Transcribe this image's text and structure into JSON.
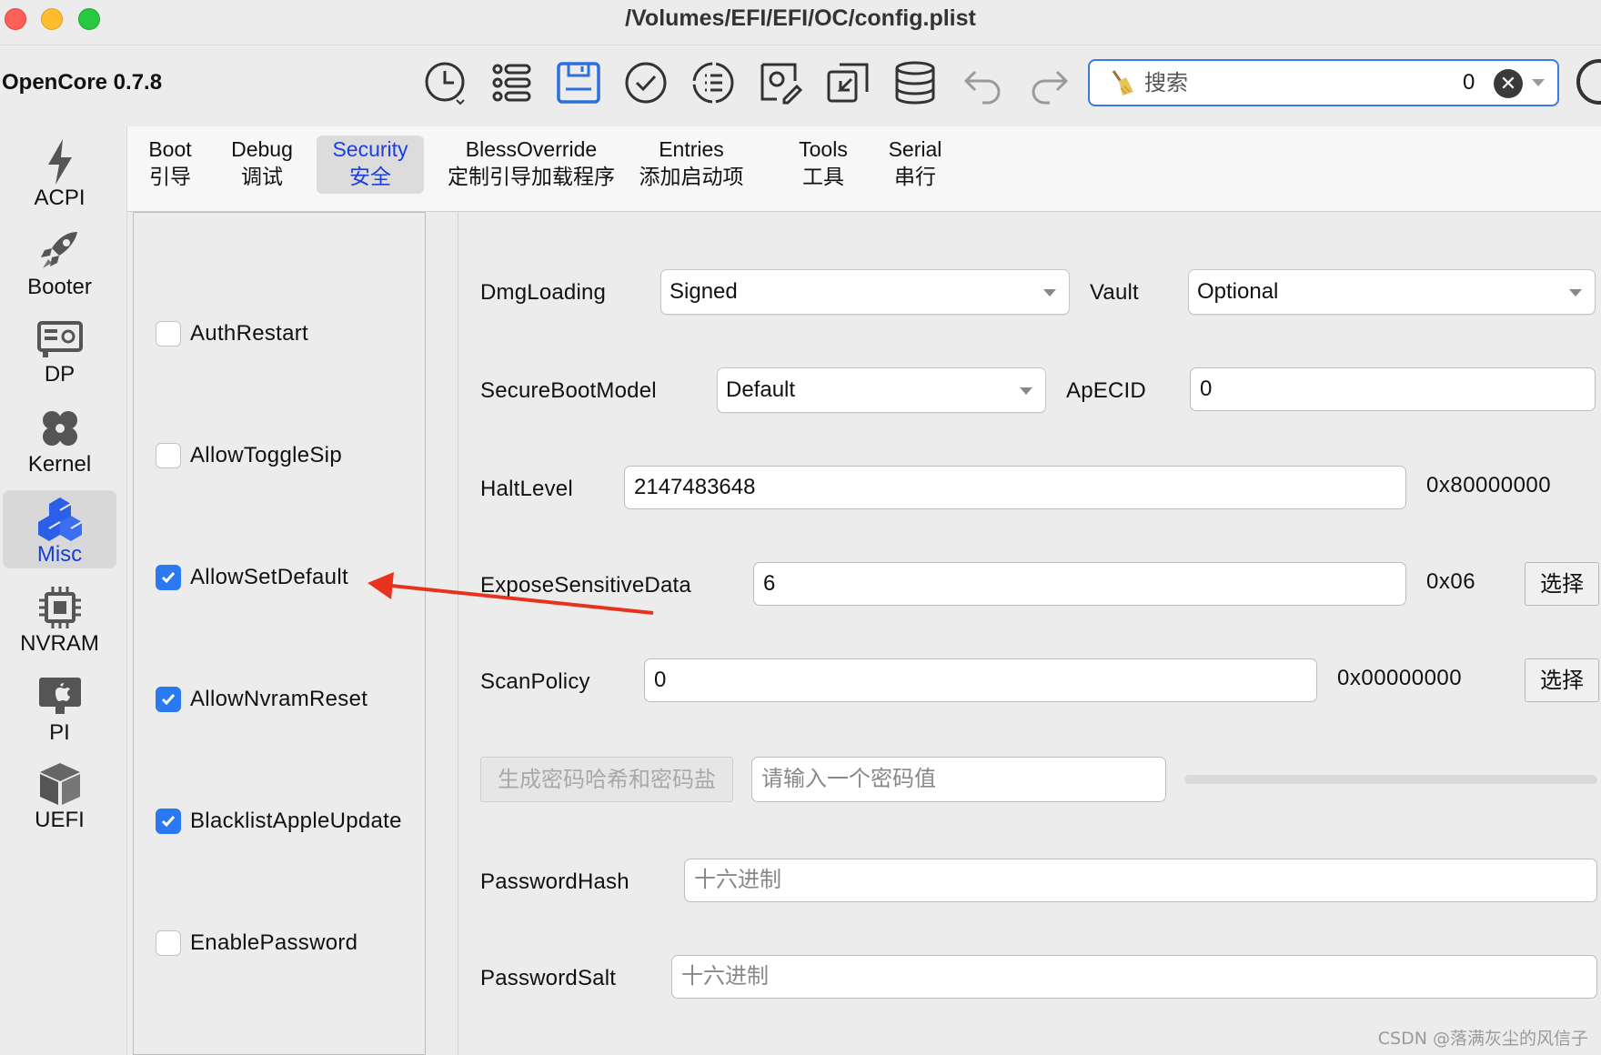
{
  "window": {
    "title": "/Volumes/EFI/EFI/OC/config.plist"
  },
  "toolbar": {
    "app_name": "OpenCore 0.7.8",
    "search": {
      "placeholder": "搜索",
      "count": "0",
      "clear": "✕"
    },
    "buttons": [
      "history-icon",
      "list-icon",
      "save-icon",
      "check-icon",
      "list-circle-icon",
      "doc-edit-icon",
      "import-icon",
      "database-icon",
      "undo-icon",
      "redo-icon"
    ],
    "accent": "#2b6fe0"
  },
  "sidebar": {
    "items": [
      {
        "label": "ACPI",
        "icon": "lightning-icon"
      },
      {
        "label": "Booter",
        "icon": "rocket-icon"
      },
      {
        "label": "DP",
        "icon": "gpu-card-icon"
      },
      {
        "label": "Kernel",
        "icon": "kernel-icon"
      },
      {
        "label": "Misc",
        "icon": "cubes-icon",
        "active": true
      },
      {
        "label": "NVRAM",
        "icon": "chip-icon"
      },
      {
        "label": "PI",
        "icon": "apple-computer-icon"
      },
      {
        "label": "UEFI",
        "icon": "box-icon"
      }
    ],
    "active_color": "#1540d8"
  },
  "tabs": [
    {
      "en": "Boot",
      "zh": "引导"
    },
    {
      "en": "Debug",
      "zh": "调试"
    },
    {
      "en": "Security",
      "zh": "安全",
      "active": true
    },
    {
      "en": "BlessOverride",
      "zh": "定制引导加载程序"
    },
    {
      "en": "Entries",
      "zh": "添加启动项"
    },
    {
      "en": "Tools",
      "zh": "工具"
    },
    {
      "en": "Serial",
      "zh": "串行"
    }
  ],
  "checkboxes": [
    {
      "label": "AuthRestart",
      "checked": false
    },
    {
      "label": "AllowToggleSip",
      "checked": false
    },
    {
      "label": "AllowSetDefault",
      "checked": true
    },
    {
      "label": "AllowNvramReset",
      "checked": true
    },
    {
      "label": "BlacklistAppleUpdate",
      "checked": true
    },
    {
      "label": "EnablePassword",
      "checked": false
    }
  ],
  "security": {
    "dmg_loading": {
      "label": "DmgLoading",
      "value": "Signed"
    },
    "vault": {
      "label": "Vault",
      "value": "Optional"
    },
    "secure_boot_model": {
      "label": "SecureBootModel",
      "value": "Default"
    },
    "apecid": {
      "label": "ApECID",
      "value": "0"
    },
    "halt_level": {
      "label": "HaltLevel",
      "value": "2147483648",
      "hex": "0x80000000"
    },
    "expose_sensitive_data": {
      "label": "ExposeSensitiveData",
      "value": "6",
      "hex": "0x06",
      "button": "选择"
    },
    "scan_policy": {
      "label": "ScanPolicy",
      "value": "0",
      "hex": "0x00000000",
      "button": "选择"
    },
    "password_gen": {
      "button": "生成密码哈希和密码盐",
      "placeholder": "请输入一个密码值"
    },
    "password_hash": {
      "label": "PasswordHash",
      "placeholder": "十六进制"
    },
    "password_salt": {
      "label": "PasswordSalt",
      "placeholder": "十六进制"
    }
  },
  "annotation": {
    "color": "#e8321e"
  },
  "watermark": "CSDN @落满灰尘的风信子"
}
